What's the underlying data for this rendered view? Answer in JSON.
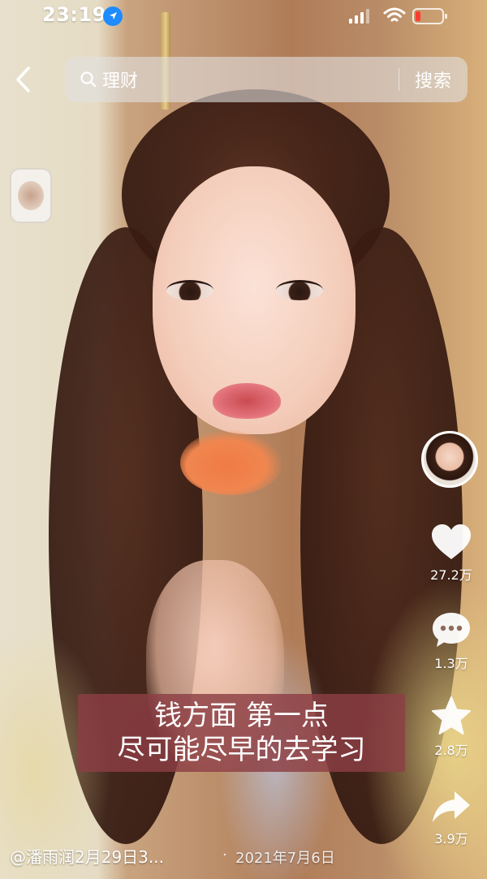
{
  "status_bar": {
    "time": "23:19"
  },
  "search": {
    "query": "理财",
    "button_label": "搜索"
  },
  "video": {
    "caption_line1": "钱方面 第一点",
    "caption_line2": "尽可能尽早的去学习",
    "author_title": "@潘雨润2月29日3...",
    "date": "2021年7月6日",
    "separator": "·"
  },
  "actions": {
    "likes": "27.2万",
    "comments": "1.3万",
    "favorites": "2.8万",
    "shares": "3.9万"
  },
  "colors": {
    "caption_bg": "#8c3e44",
    "location_badge": "#1e8bff",
    "battery_low": "#ff3b30"
  }
}
